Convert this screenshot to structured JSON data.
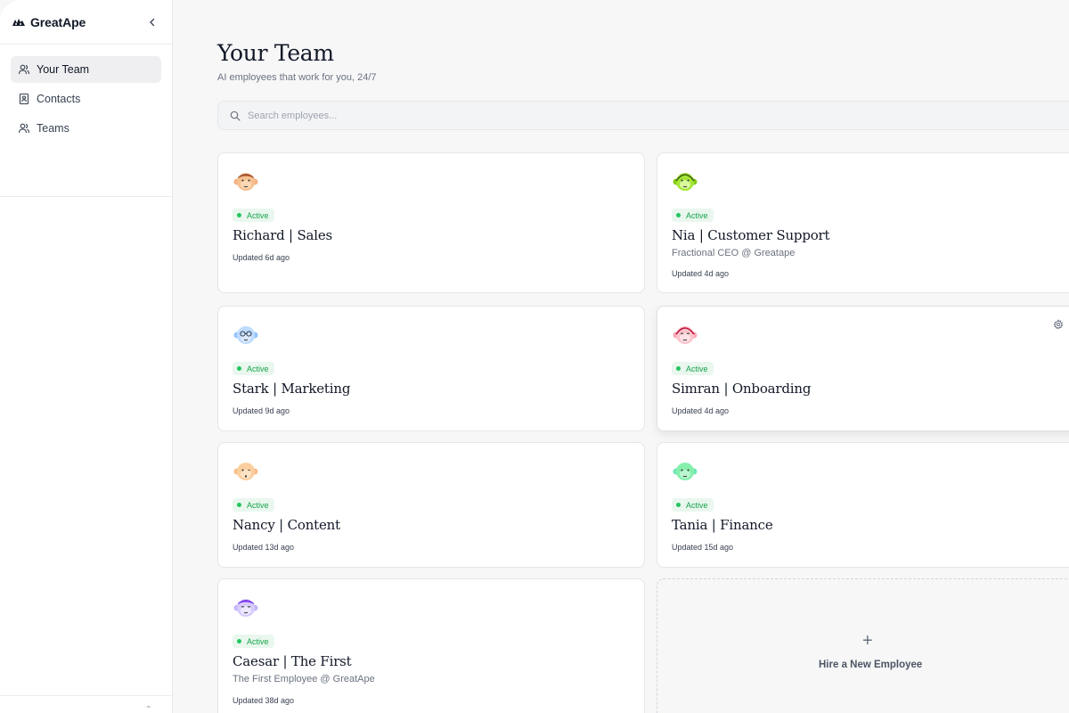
{
  "app": {
    "name": "GreatApe"
  },
  "sidebar": {
    "items": [
      {
        "label": "Your Team",
        "icon": "users-icon",
        "active": true
      },
      {
        "label": "Contacts",
        "icon": "contact-book-icon"
      },
      {
        "label": "Teams",
        "icon": "users-icon"
      }
    ]
  },
  "page": {
    "title": "Your Team",
    "subtitle": "AI employees that work for you, 24/7"
  },
  "search": {
    "placeholder": "Search employees...",
    "value": ""
  },
  "status_colors": {
    "active_bg": "#e9f7ee",
    "active_text": "#16a34a",
    "active_dot": "#22c55e"
  },
  "employees": [
    {
      "name": "Richard | Sales",
      "status": "Active",
      "subtitle": "",
      "updated": "Updated 6d ago",
      "avatar": "orange-ape-avatar"
    },
    {
      "name": "Nia | Customer Support",
      "status": "Active",
      "subtitle": "Fractional CEO @ Greatape",
      "updated": "Updated 4d ago",
      "avatar": "green-ape-headset-avatar"
    },
    {
      "name": "Stark | Marketing",
      "status": "Active",
      "subtitle": "",
      "updated": "Updated 9d ago",
      "avatar": "blue-ape-glasses-avatar"
    },
    {
      "name": "Simran | Onboarding",
      "status": "Active",
      "subtitle": "",
      "updated": "Updated 4d ago",
      "avatar": "pink-ape-headset-avatar"
    },
    {
      "name": "Nancy | Content",
      "status": "Active",
      "subtitle": "",
      "updated": "Updated 13d ago",
      "avatar": "peach-ape-avatar"
    },
    {
      "name": "Tania | Finance",
      "status": "Active",
      "subtitle": "",
      "updated": "Updated 15d ago",
      "avatar": "mint-ape-avatar"
    },
    {
      "name": "Caesar | The First",
      "status": "Active",
      "subtitle": "The First Employee @ GreatApe",
      "updated": "Updated 38d ago",
      "avatar": "purple-ape-avatar"
    }
  ],
  "hire": {
    "label": "Hire a New Employee"
  },
  "card_actions": [
    "settings-gear-icon",
    "trash-icon"
  ]
}
